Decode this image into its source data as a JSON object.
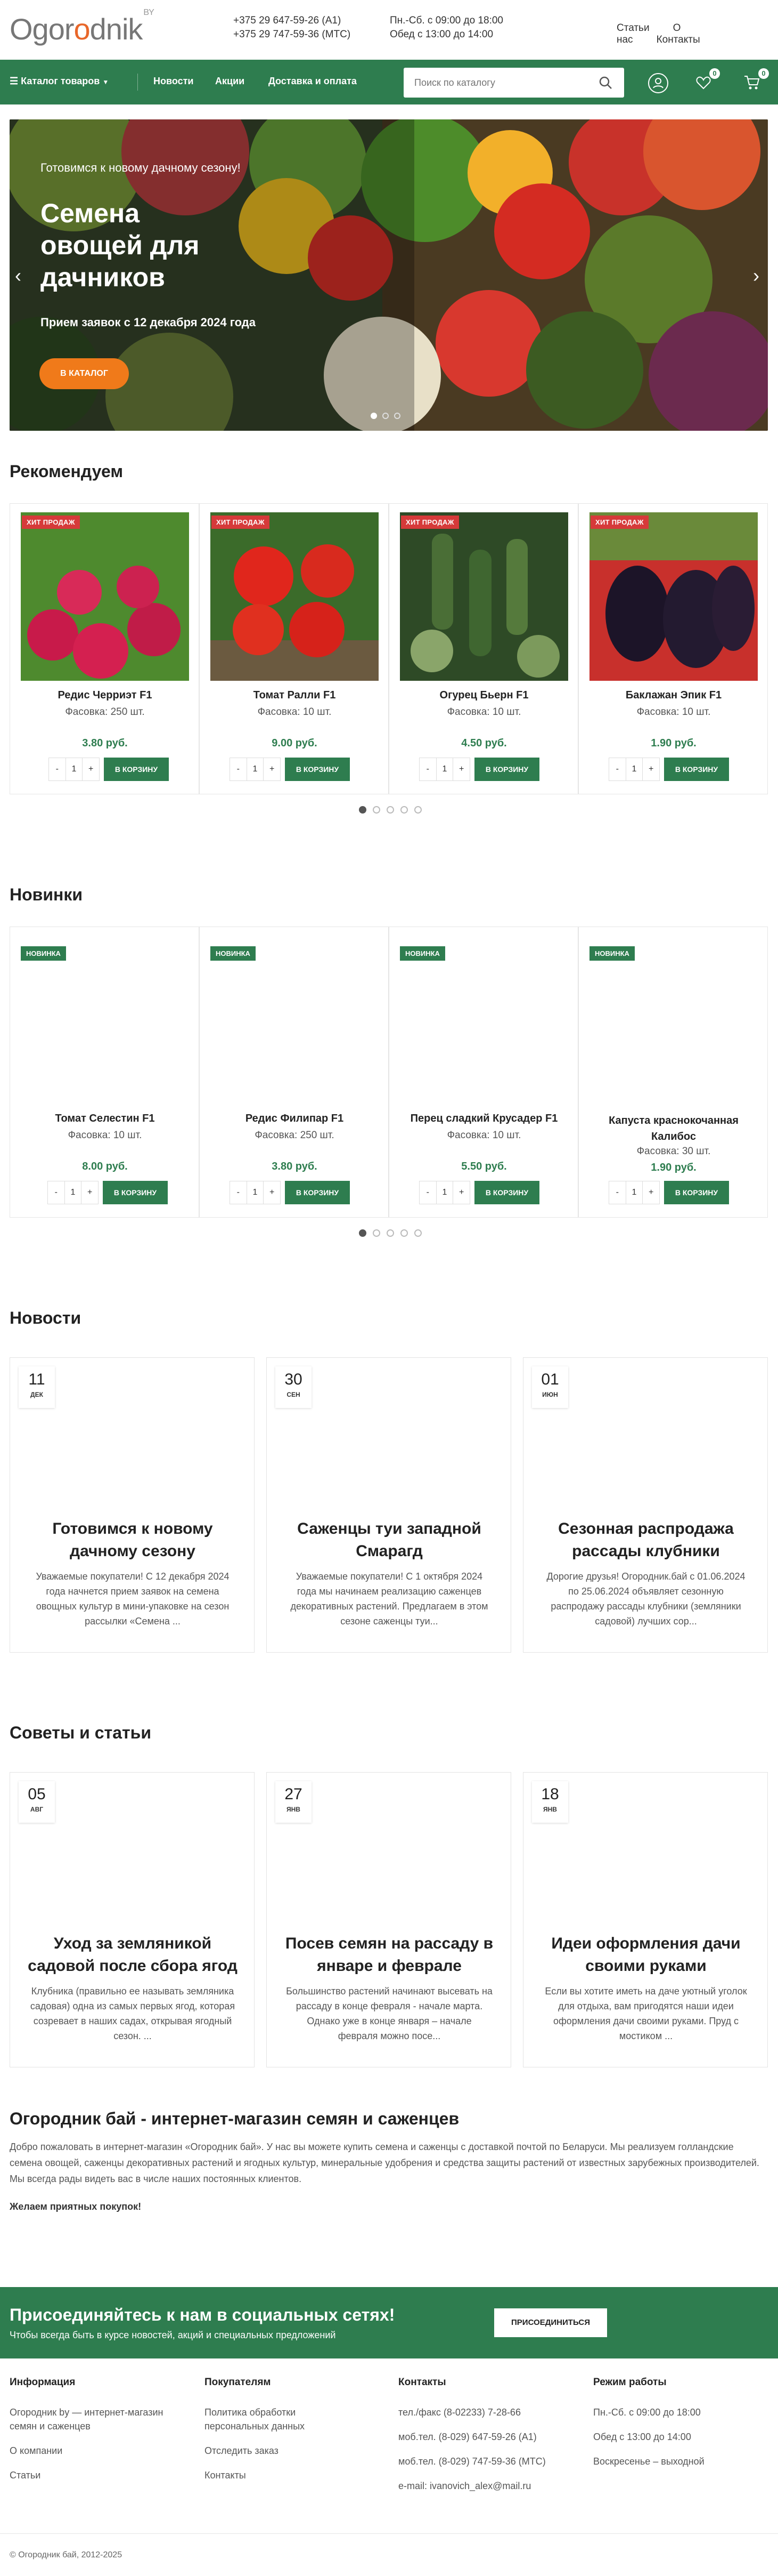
{
  "header": {
    "logo_part1": "Ogor",
    "logo_part2": "o",
    "logo_part3": "dnik",
    "logo_sup": "BY",
    "phone1": "+375 29 647-59-26 (A1)",
    "phone2": "+375 29 747-59-36 (MTC)",
    "hours1": "Пн.-Сб. с 09:00 до 18:00",
    "hours2": "Обед с 13:00 до 14:00",
    "links": [
      "Статьи",
      "О нас",
      "Контакты"
    ]
  },
  "nav": {
    "catalog": "Каталог товаров",
    "items": [
      "Новости",
      "Акции",
      "Доставка и оплата"
    ],
    "search_placeholder": "Поиск по каталогу",
    "favorites_count": "0",
    "cart_count": "0"
  },
  "hero": {
    "subtitle": "Готовимся к новому дачному сезону!",
    "title_line1": "Семена",
    "title_line2": "овощей для",
    "title_line3": "дачников",
    "note": "Прием заявок с 12 декабря 2024 года",
    "button": "В КАТАЛОГ"
  },
  "recommended": {
    "title": "Рекомендуем",
    "badge": "ХИТ ПРОДАЖ",
    "cart_label": "В КОРЗИНУ",
    "qty": "1",
    "products": [
      {
        "name": "Редис Черриэт F1",
        "pack": "Фасовка: 250 шт.",
        "price": "3.80 руб."
      },
      {
        "name": "Томат Ралли F1",
        "pack": "Фасовка: 10 шт.",
        "price": "9.00 руб."
      },
      {
        "name": "Огурец Бьерн F1",
        "pack": "Фасовка: 10 шт.",
        "price": "4.50 руб."
      },
      {
        "name": "Баклажан Эпик F1",
        "pack": "Фасовка: 10 шт.",
        "price": "1.90 руб."
      }
    ]
  },
  "novelties": {
    "title": "Новинки",
    "badge": "НОВИНКА",
    "cart_label": "В КОРЗИНУ",
    "qty": "1",
    "products": [
      {
        "name": "Томат Селестин F1",
        "pack": "Фасовка: 10 шт.",
        "price": "8.00 руб."
      },
      {
        "name": "Редис Филипар F1",
        "pack": "Фасовка: 250 шт.",
        "price": "3.80 руб."
      },
      {
        "name": "Перец сладкий Крусадер F1",
        "pack": "Фасовка: 10 шт.",
        "price": "5.50 руб."
      },
      {
        "name": "Капуста краснокочанная Калибос",
        "name_line2": "",
        "pack": "Фасовка: 30 шт.",
        "price": "1.90 руб."
      }
    ]
  },
  "news": {
    "title": "Новости",
    "items": [
      {
        "day": "11",
        "month": "ДЕК",
        "title": "Готовимся к новому дачному сезону",
        "text": "Уважаемые покупатели! С 12 декабря 2024 года начнется прием заявок на семена овощных культур в мини-упаковке на сезон рассылки «Семена ..."
      },
      {
        "day": "30",
        "month": "СЕН",
        "title": "Саженцы туи западной Смарагд",
        "text": "Уважаемые покупатели! С 1 октября 2024 года мы начинаем реализацию саженцев декоративных растений. Предлагаем в этом сезоне саженцы туи..."
      },
      {
        "day": "01",
        "month": "ИЮН",
        "title": "Сезонная распродажа рассады клубники",
        "text": "Дорогие друзья! Огородник.бай с 01.06.2024 по 25.06.2024 объявляет сезонную распродажу рассады клубники (земляники садовой) лучших сор..."
      }
    ]
  },
  "articles": {
    "title": "Советы и статьи",
    "items": [
      {
        "day": "05",
        "month": "АВГ",
        "title": "Уход за земляникой садовой после сбора ягод",
        "text": "Клубника (правильно ее называть земляника садовая) одна из самых первых ягод, которая созревает в наших садах, открывая ягодный сезон. ..."
      },
      {
        "day": "27",
        "month": "ЯНВ",
        "title": "Посев семян на рассаду в январе и феврале",
        "text": "Большинство растений начинают высевать на рассаду в конце февраля - начале марта. Однако уже в конце января – начале февраля можно посе..."
      },
      {
        "day": "18",
        "month": "ЯНВ",
        "title": "Идеи оформления дачи своими руками",
        "text": "Если вы хотите иметь на даче уютный уголок для отдыха, вам пригодятся наши идеи оформления дачи своими руками. Пруд с мостиком ..."
      }
    ]
  },
  "about": {
    "title": "Огородник бай - интернет-магазин семян и саженцев",
    "text": "Добро пожаловать в интернет-магазин «Огородник бай». У нас вы можете купить семена и саженцы с доставкой почтой по Беларуси. Мы реализуем голландские семена овощей, саженцы декоративных растений и ягодных культур, минеральные удобрения и средства защиты растений от известных зарубежных производителей. Мы всегда рады видеть вас в числе наших постоянных клиентов.",
    "wish": "Желаем приятных покупок!"
  },
  "social": {
    "title": "Присоединяйтесь к нам в социальных сетях!",
    "text": "Чтобы всегда быть в курсе новостей, акций и специальных предложений",
    "button": "ПРИСОЕДИНИТЬСЯ"
  },
  "footer": {
    "info_title": "Информация",
    "info_items": [
      "Огородник by — интернет-магазин семян и саженцев",
      "О компании",
      "Статьи"
    ],
    "buyers_title": "Покупателям",
    "buyers_items": [
      "Политика обработки персональных данных",
      "Отследить заказ",
      "Контакты"
    ],
    "contacts_title": "Контакты",
    "contacts_items": [
      "тел./факс (8-02233) 7-28-66",
      "моб.тел. (8-029) 647-59-26 (A1)",
      "моб.тел. (8-029) 747-59-36 (МТС)",
      "e-mail: ivanovich_alex@mail.ru"
    ],
    "hours_title": "Режим работы",
    "hours_items": [
      "Пн.-Сб. с 09:00 до 18:00",
      "Обед с 13:00 до 14:00",
      "Воскресенье – выходной"
    ],
    "copyright": "© Огородник бай, 2012-2025"
  }
}
